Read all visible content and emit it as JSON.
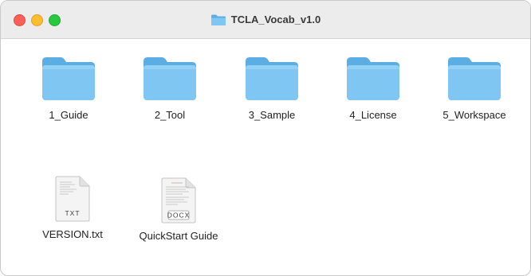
{
  "window": {
    "title": "TCLA_Vocab_v1.0"
  },
  "items": [
    {
      "label": "1_Guide",
      "kind": "folder"
    },
    {
      "label": "2_Tool",
      "kind": "folder"
    },
    {
      "label": "3_Sample",
      "kind": "folder"
    },
    {
      "label": "4_License",
      "kind": "folder"
    },
    {
      "label": "5_Workspace",
      "kind": "folder"
    },
    {
      "label": "VERSION.txt",
      "kind": "document",
      "badge": "TXT"
    },
    {
      "label": "QuickStart Guide",
      "kind": "document",
      "badge": "DOCX"
    }
  ],
  "colors": {
    "folder_body": "#7fc6f3",
    "folder_tab": "#5aaee4",
    "close": "#fe5f57",
    "minimize": "#febc2e",
    "maximize": "#28c840"
  }
}
